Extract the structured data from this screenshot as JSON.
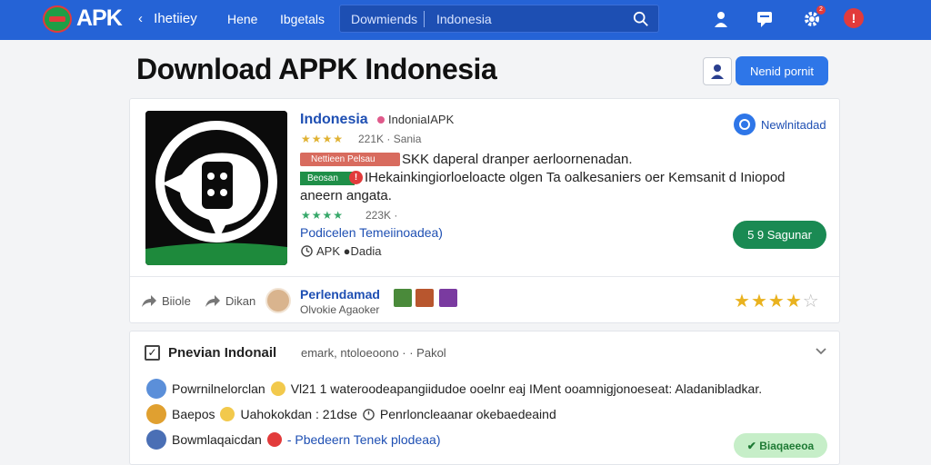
{
  "nav": {
    "logo": "APK",
    "back_label": "Ihetiiey",
    "links": [
      "Hene",
      "Ibgetals"
    ],
    "search_category": "Dowmiends",
    "search_placeholder": "Indonesia",
    "notif_count": "2",
    "alert_symbol": "!"
  },
  "header": {
    "title": "Download APPK Indonesia",
    "primary_button": "Nenid pornit"
  },
  "app": {
    "name": "Indonesia",
    "tag": "IndoniaIAPK",
    "stars_small": "★★★★",
    "meta1": "221K · Sania",
    "badge_red": "Nettieen Pelsau",
    "desc1": "SKK daperal dranper aerloornenadan.",
    "badge_green": "Beosan",
    "desc2": "IHekainkingiorloeloacte olgen Ta oalkesaniers oer Kemsanit d Iniopod",
    "desc3": "aneern angata.",
    "stars_green": "★★★★",
    "meta2": "223K ·",
    "developer_link": "Podicelen Temeiinoadea)",
    "size": "APK ●Dadia",
    "verified_label": "Newlnitadad",
    "download_button": "5 9 Sagunar"
  },
  "actions": {
    "share": "Biiole",
    "send": "Dikan"
  },
  "author": {
    "name": "Perlendamad",
    "subtitle": "Olvokie Agaoker",
    "rating_value": 4,
    "rating_max": 5
  },
  "panel": {
    "title": "Pnevian Indonail",
    "subtitle": "emark, ntoloeoono · · Pakol",
    "rows": [
      {
        "label": "Powrnilnelorclan",
        "text": "Vl21  1 wateroodeapangiidudoe ooelnr eaj  IMent ooamnigjonoeseat: Aladanibladkar."
      },
      {
        "label": "Baepos",
        "text": "Uahokokdan : 21dse"
      },
      {
        "label": "Bowmlaqaicdan",
        "text": "- Pbedeern Tenek plodeaa)"
      }
    ],
    "row2_extra": "Penrloncleaanar okebaedeaind",
    "ok_button": "Biaqaeeoa"
  },
  "colors": {
    "brand": "#2563d6",
    "accent": "#2e76e8",
    "success": "#1a8a53",
    "danger": "#e23b3b",
    "star": "#e9b21f"
  }
}
